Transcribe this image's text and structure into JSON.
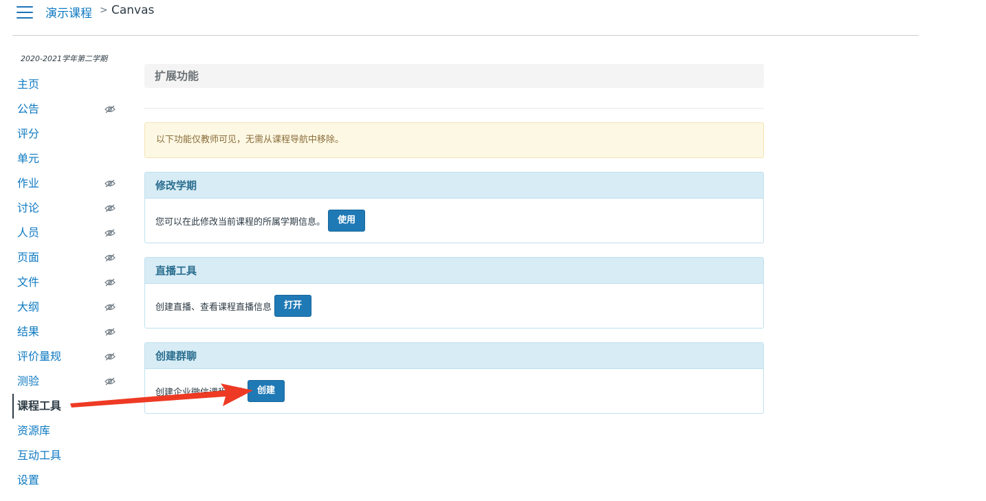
{
  "header": {
    "course_name": "演示课程",
    "separator": ">",
    "current_page": "Canvas"
  },
  "sidebar": {
    "term": "2020-2021学年第二学期",
    "items": [
      {
        "label": "主页",
        "hidden": false
      },
      {
        "label": "公告",
        "hidden": true
      },
      {
        "label": "评分",
        "hidden": false
      },
      {
        "label": "单元",
        "hidden": false
      },
      {
        "label": "作业",
        "hidden": true
      },
      {
        "label": "讨论",
        "hidden": true
      },
      {
        "label": "人员",
        "hidden": true
      },
      {
        "label": "页面",
        "hidden": true
      },
      {
        "label": "文件",
        "hidden": true
      },
      {
        "label": "大纲",
        "hidden": true
      },
      {
        "label": "结果",
        "hidden": true
      },
      {
        "label": "评价量规",
        "hidden": true
      },
      {
        "label": "测验",
        "hidden": true
      },
      {
        "label": "课程工具",
        "hidden": false,
        "active": true
      },
      {
        "label": "资源库",
        "hidden": false
      },
      {
        "label": "互动工具",
        "hidden": false
      },
      {
        "label": "设置",
        "hidden": false
      }
    ]
  },
  "main": {
    "heading": "扩展功能",
    "notice": "以下功能仅教师可见，无需从课程导航中移除。",
    "panels": [
      {
        "title": "修改学期",
        "description": "您可以在此修改当前课程的所属学期信息。",
        "button": "使用"
      },
      {
        "title": "直播工具",
        "description": "创建直播、查看课程直播信息",
        "button": "打开"
      },
      {
        "title": "创建群聊",
        "description": "创建企业微信课程群聊",
        "button": "创建"
      }
    ]
  },
  "colors": {
    "link": "#0d79c2",
    "button": "#1f79b5",
    "panel_header": "#d7ecf5",
    "notice_bg": "#fdf8e4",
    "annotation_arrow": "#ee3a24"
  },
  "icons": {
    "menu": "hamburger-icon",
    "hidden_item": "eye-slash-icon"
  }
}
